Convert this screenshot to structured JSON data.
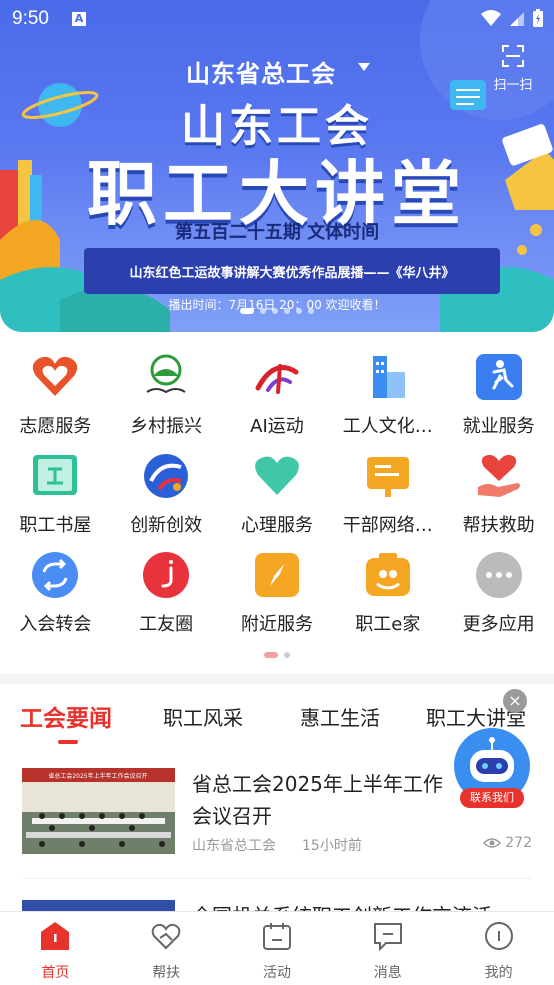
{
  "status_bar": {
    "time": "9:50",
    "notif": "A"
  },
  "header": {
    "org_title": "山东省总工会",
    "scan_label": "扫一扫"
  },
  "banner": {
    "line1": "山东工会",
    "line2": "职工大讲堂",
    "sub": "第五百二十五期  文体时间",
    "strip_title": "山东红色工运故事讲解大赛优秀作品展播——《华八井》",
    "air_time": "播出时间：7月16日 20：00 欢迎收看！"
  },
  "grid": {
    "rows": [
      [
        {
          "label": "志愿服务",
          "icon": "volunteer-heart-icon",
          "color": "#e8532c"
        },
        {
          "label": "乡村振兴",
          "icon": "rural-revitalization-icon",
          "color": "#2e9a3a"
        },
        {
          "label": "AI运动",
          "icon": "ai-sport-icon",
          "color": "#d8232c"
        },
        {
          "label": "工人文化…",
          "icon": "workers-culture-building-icon",
          "color": "#3a8ef0"
        },
        {
          "label": "就业服务",
          "icon": "employment-runner-icon",
          "color": "#3a7ef0"
        }
      ],
      [
        {
          "label": "职工书屋",
          "icon": "book-icon",
          "color": "#2fbf9a"
        },
        {
          "label": "创新创效",
          "icon": "innovation-icon",
          "color": "#2a5fd8"
        },
        {
          "label": "心理服务",
          "icon": "heart-icon",
          "color": "#3fc7a8"
        },
        {
          "label": "干部网络…",
          "icon": "cadre-network-icon",
          "color": "#f5a623"
        },
        {
          "label": "帮扶救助",
          "icon": "help-hand-heart-icon",
          "color": "#e8433c"
        }
      ],
      [
        {
          "label": "入会转会",
          "icon": "transfer-icon",
          "color": "#4a8ef5"
        },
        {
          "label": "工友圈",
          "icon": "workmate-circle-icon",
          "color": "#e8333c"
        },
        {
          "label": "附近服务",
          "icon": "compass-icon",
          "color": "#f5a623"
        },
        {
          "label": "职工e家",
          "icon": "worker-home-icon",
          "color": "#f5a623"
        },
        {
          "label": "更多应用",
          "icon": "more-dots-icon",
          "color": "#bbbbbb"
        }
      ]
    ]
  },
  "tabs": {
    "items": [
      "工会要闻",
      "职工风采",
      "惠工生活",
      "职工大讲堂"
    ],
    "active": 0
  },
  "assistant": {
    "label": "联系我们",
    "close": "×"
  },
  "news": [
    {
      "title": "省总工会2025年上半年工作会议召开",
      "source": "山东省总工会",
      "time": "15小时前",
      "views": "272",
      "thumb_caption": "省总工会2025年上半年工作会议召开"
    },
    {
      "title": "全国机关系统职工创新工作交流活"
    }
  ],
  "bottom_nav": {
    "items": [
      {
        "label": "首页",
        "icon": "home-icon"
      },
      {
        "label": "帮扶",
        "icon": "help-handshake-icon"
      },
      {
        "label": "活动",
        "icon": "activity-icon"
      },
      {
        "label": "消息",
        "icon": "message-icon"
      },
      {
        "label": "我的",
        "icon": "profile-icon"
      }
    ],
    "active": 0
  },
  "colors": {
    "accent": "#e8332c",
    "banner_blue": "#4a6be8"
  }
}
